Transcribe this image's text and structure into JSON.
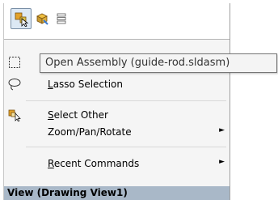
{
  "toolbar": {
    "buttons": [
      {
        "icon": "open-assembly-icon",
        "active": true
      },
      {
        "icon": "open-part-icon",
        "active": false
      },
      {
        "icon": "list-icon",
        "active": false
      }
    ]
  },
  "menu": {
    "items": [
      {
        "icon": "box-select-icon",
        "label": "",
        "accel": "",
        "has_submenu": false
      },
      {
        "icon": "lasso-icon",
        "label": "asso Selection",
        "accel": "L",
        "has_submenu": false
      },
      {
        "icon": "select-other-icon",
        "label": "elect Other",
        "accel": "S",
        "has_submenu": false
      },
      {
        "icon": "",
        "label": "Zoom/Pan/Rotate",
        "accel": "",
        "has_submenu": true
      },
      {
        "icon": "",
        "label": "ecent Commands",
        "accel": "R",
        "has_submenu": true
      }
    ],
    "section_header": "View (Drawing View1)"
  },
  "tooltip": {
    "text": "Open Assembly (guide-rod.sldasm)"
  },
  "colors": {
    "menu_bg": "#f5f5f5",
    "section_bg": "#a9b8c8",
    "active_btn_bg": "#dce8f4"
  }
}
